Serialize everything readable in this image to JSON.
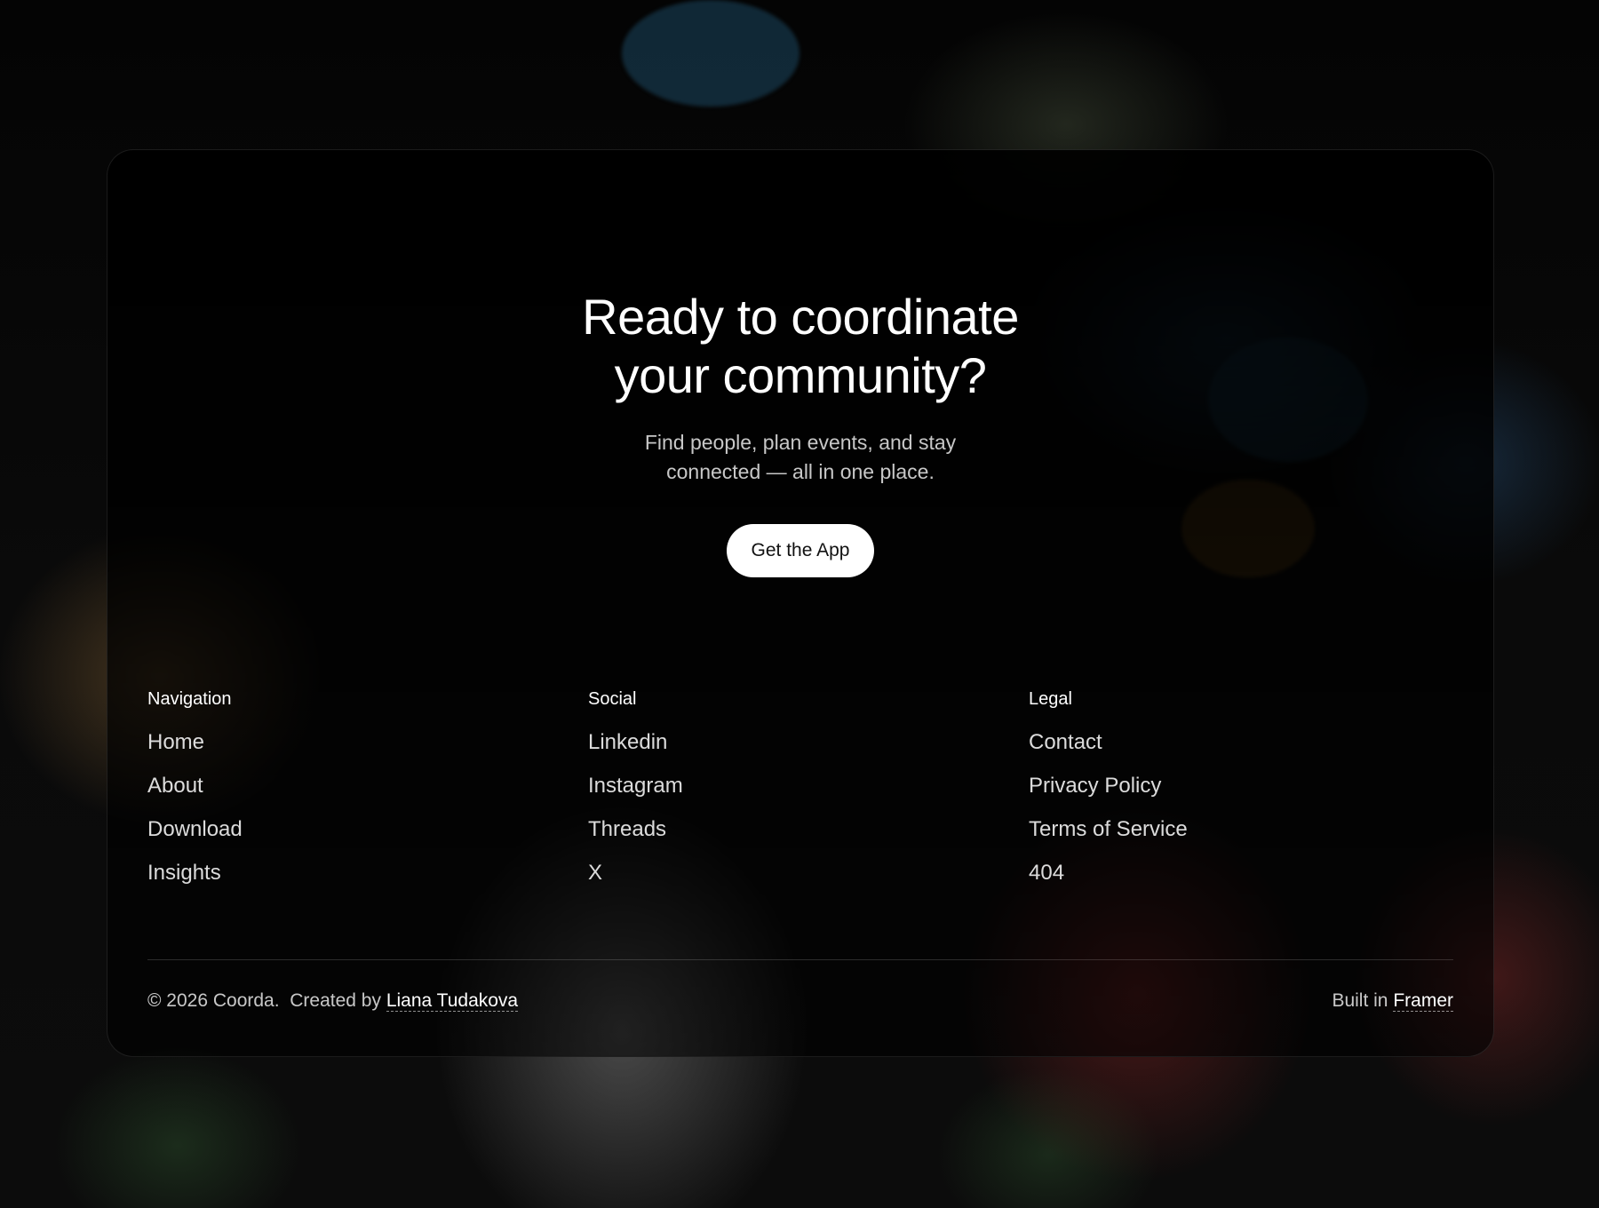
{
  "hero": {
    "title_line1": "Ready to coordinate",
    "title_line2": "your community?",
    "subtitle": "Find people, plan events, and stay connected — all in one place.",
    "cta_label": "Get the App"
  },
  "footer": {
    "columns": [
      {
        "heading": "Navigation",
        "links": [
          "Home",
          "About",
          "Download",
          "Insights"
        ]
      },
      {
        "heading": "Social",
        "links": [
          "Linkedin",
          "Instagram",
          "Threads",
          "X"
        ]
      },
      {
        "heading": "Legal",
        "links": [
          "Contact",
          "Privacy Policy",
          "Terms of Service",
          "404"
        ]
      }
    ],
    "copyright": "© 2026 Coorda.",
    "created_by_prefix": "Created by",
    "author_name": "Liana Tudakova",
    "built_in_prefix": "Built in",
    "builder_name": "Framer"
  },
  "colors": {
    "card_background": "#000000",
    "cta_background": "#ffffff",
    "cta_text": "#111111",
    "text_primary": "#ffffff"
  }
}
